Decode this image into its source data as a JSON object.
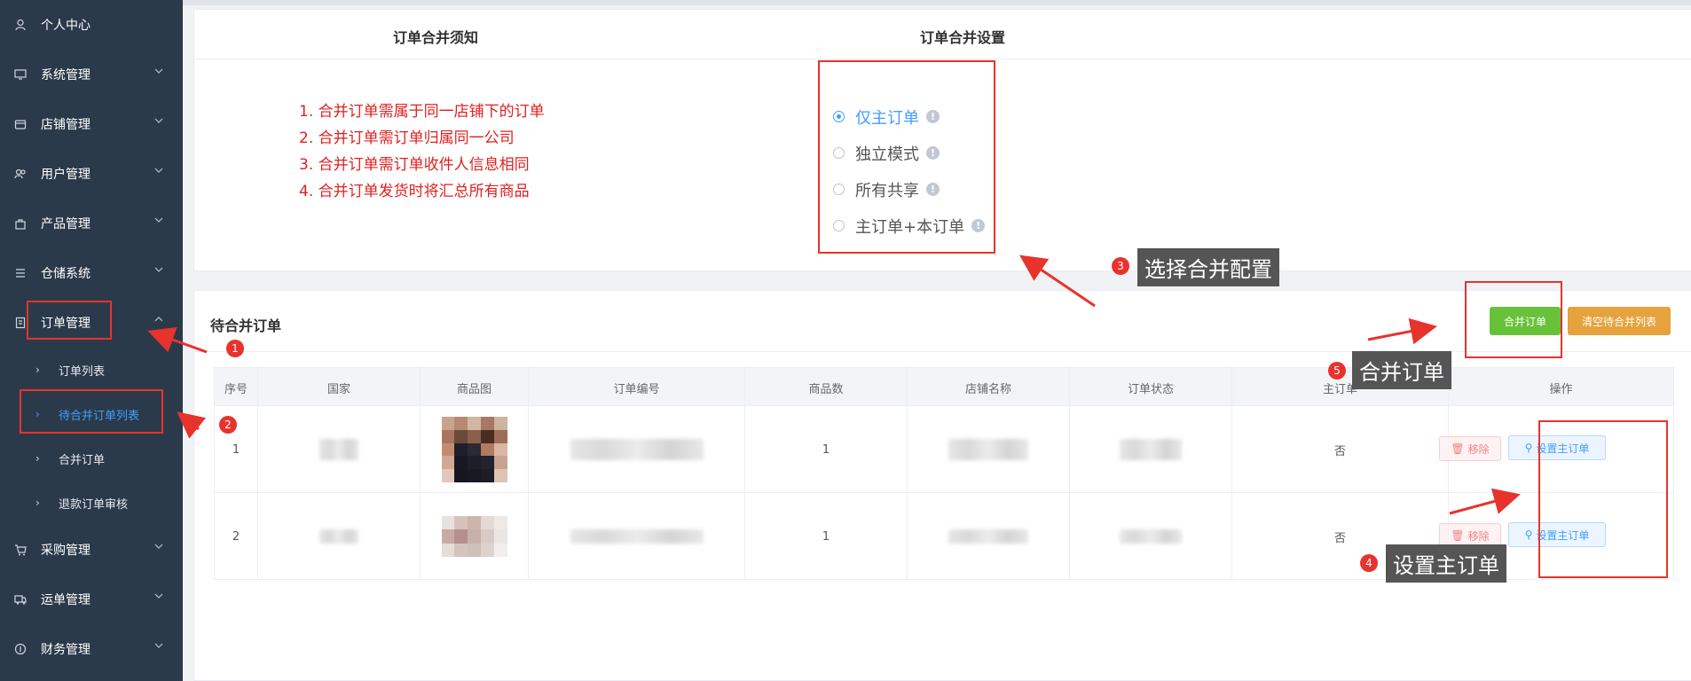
{
  "sidebar": {
    "items": [
      {
        "label": "个人中心",
        "icon": "user-icon"
      },
      {
        "label": "系统管理",
        "icon": "monitor-icon"
      },
      {
        "label": "店铺管理",
        "icon": "shop-icon"
      },
      {
        "label": "用户管理",
        "icon": "users-icon"
      },
      {
        "label": "产品管理",
        "icon": "bag-icon"
      },
      {
        "label": "仓储系统",
        "icon": "list-icon"
      },
      {
        "label": "订单管理",
        "icon": "document-icon"
      },
      {
        "label": "采购管理",
        "icon": "cart-icon"
      },
      {
        "label": "运单管理",
        "icon": "truck-icon"
      },
      {
        "label": "财务管理",
        "icon": "coin-icon"
      }
    ],
    "subitems": [
      {
        "label": "订单列表"
      },
      {
        "label": "待合并订单列表"
      },
      {
        "label": "合并订单"
      },
      {
        "label": "退款订单审核"
      }
    ]
  },
  "merge_card": {
    "notes_title": "订单合并须知",
    "settings_title": "订单合并设置",
    "notes": [
      "1. 合并订单需属于同一店铺下的订单",
      "2. 合并订单需订单归属同一公司",
      "3. 合并订单需订单收件人信息相同",
      "4. 合并订单发货时将汇总所有商品"
    ],
    "options": [
      {
        "label": "仅主订单",
        "checked": true
      },
      {
        "label": "独立模式",
        "checked": false
      },
      {
        "label": "所有共享",
        "checked": false
      },
      {
        "label": "主订单+本订单",
        "checked": false
      }
    ],
    "info_glyph": "!"
  },
  "pending_card": {
    "title": "待合并订单",
    "merge_button": "合并订单",
    "clear_button": "清空待合并列表",
    "columns": [
      "序号",
      "国家",
      "商品图",
      "订单编号",
      "商品数",
      "店铺名称",
      "订单状态",
      "主订单",
      "操作"
    ],
    "rows": [
      {
        "index": "1",
        "count": "1",
        "main": "否",
        "remove": "移除",
        "set_main": "设置主订单"
      },
      {
        "index": "2",
        "count": "1",
        "main": "否",
        "remove": "移除",
        "set_main": "设置主订单"
      }
    ]
  },
  "annotations": {
    "tip3": "选择合并配置",
    "tip5": "合并订单",
    "tip4": "设置主订单",
    "badges": [
      "1",
      "2",
      "3",
      "4",
      "5"
    ]
  },
  "colors": {
    "sidebar_bg": "#2b3a4a",
    "accent": "#409eff",
    "danger": "#e8332d",
    "success": "#67c23a",
    "warning": "#e6a23c"
  }
}
